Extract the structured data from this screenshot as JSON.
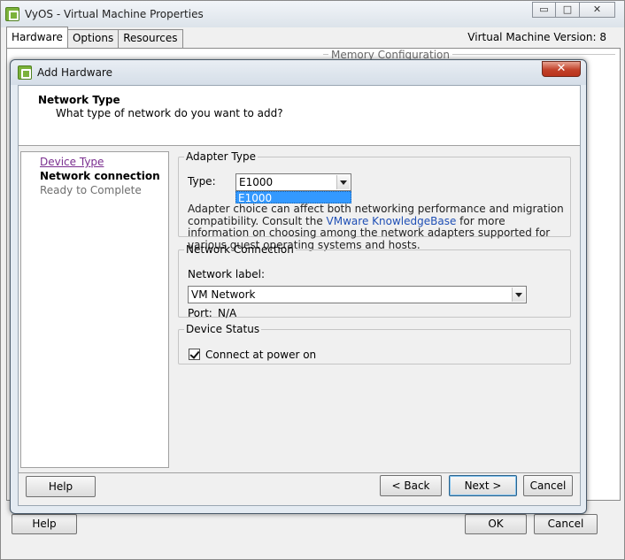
{
  "background_window": {
    "title": "VyOS - Virtual Machine Properties",
    "controls": {
      "minimize": "▭",
      "maximize": "□",
      "close": "✕"
    },
    "tabs": [
      {
        "label": "Hardware",
        "active": true
      },
      {
        "label": "Options",
        "active": false
      },
      {
        "label": "Resources",
        "active": false
      }
    ],
    "version_label": "Virtual Machine Version: 8",
    "memory_group_label": "Memory Configuration",
    "help_button": "Help",
    "ok_button": "OK",
    "cancel_button": "Cancel"
  },
  "dialog": {
    "title": "Add Hardware",
    "close_glyph": "✕",
    "header": {
      "title": "Network Type",
      "subtitle": "What type of network do you want to add?"
    },
    "steps": [
      {
        "label": "Device Type",
        "state": "link"
      },
      {
        "label": "Network connection",
        "state": "current"
      },
      {
        "label": "Ready to Complete",
        "state": "pending"
      }
    ],
    "adapter_type": {
      "group_label": "Adapter Type",
      "type_label": "Type:",
      "selected": "E1000",
      "dropdown_options": [
        "E1000"
      ],
      "description_before_link": "Adapter choice can affect both networking performance and migration compatibility. Consult the",
      "link_text": "VMware KnowledgeBase",
      "description_after_link": "for more information on choosing among the network adapters supported for various guest operating systems and hosts."
    },
    "network_connection": {
      "group_label": "Network Connection",
      "network_label_caption": "Network label:",
      "network_selected": "VM Network",
      "port_label": "Port:",
      "port_value": "N/A"
    },
    "device_status": {
      "group_label": "Device Status",
      "connect_at_power_on_label": "Connect at power on",
      "connect_at_power_on_checked": true
    },
    "buttons": {
      "help": "Help",
      "back": "< Back",
      "next": "Next >",
      "cancel": "Cancel"
    }
  },
  "colors": {
    "selection_blue": "#3399ff",
    "link_blue": "#1f4fb5",
    "visited_link_purple": "#7a2e8f",
    "dialog_close_red": "#c2422a",
    "vmware_green": "#7bb23b"
  }
}
